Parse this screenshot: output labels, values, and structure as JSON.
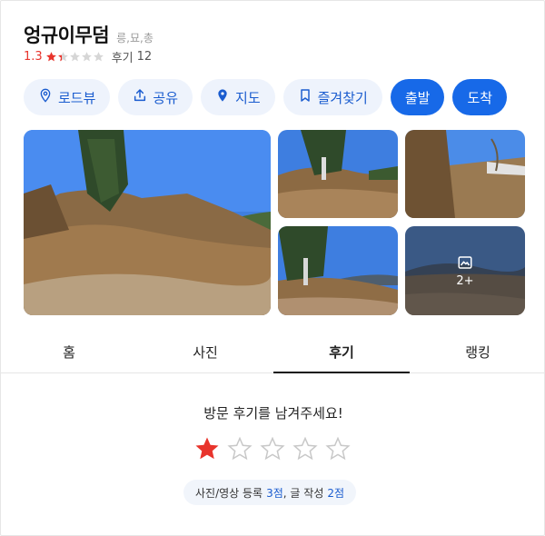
{
  "place": {
    "name": "엉규이무덤",
    "category": "릉,묘,총",
    "rating": "1.3",
    "review_label": "후기",
    "review_count": "12"
  },
  "actions": {
    "roadview": "로드뷰",
    "share": "공유",
    "map": "지도",
    "bookmark": "즐겨찾기",
    "depart": "출발",
    "arrive": "도착"
  },
  "photos": {
    "more_label": "2+"
  },
  "tabs": [
    {
      "label": "홈"
    },
    {
      "label": "사진"
    },
    {
      "label": "후기"
    },
    {
      "label": "랭킹"
    }
  ],
  "review": {
    "prompt": "방문 후기를 남겨주세요!",
    "selected_stars": 1,
    "max_stars": 5,
    "points_photo_label": "사진/영상 등록",
    "points_photo_value": "3점",
    "points_text_label": ", 글 작성",
    "points_text_value": "2점"
  },
  "colors": {
    "accent": "#1769e8",
    "rating": "#e8342c",
    "pill_bg": "#eef3fc"
  }
}
